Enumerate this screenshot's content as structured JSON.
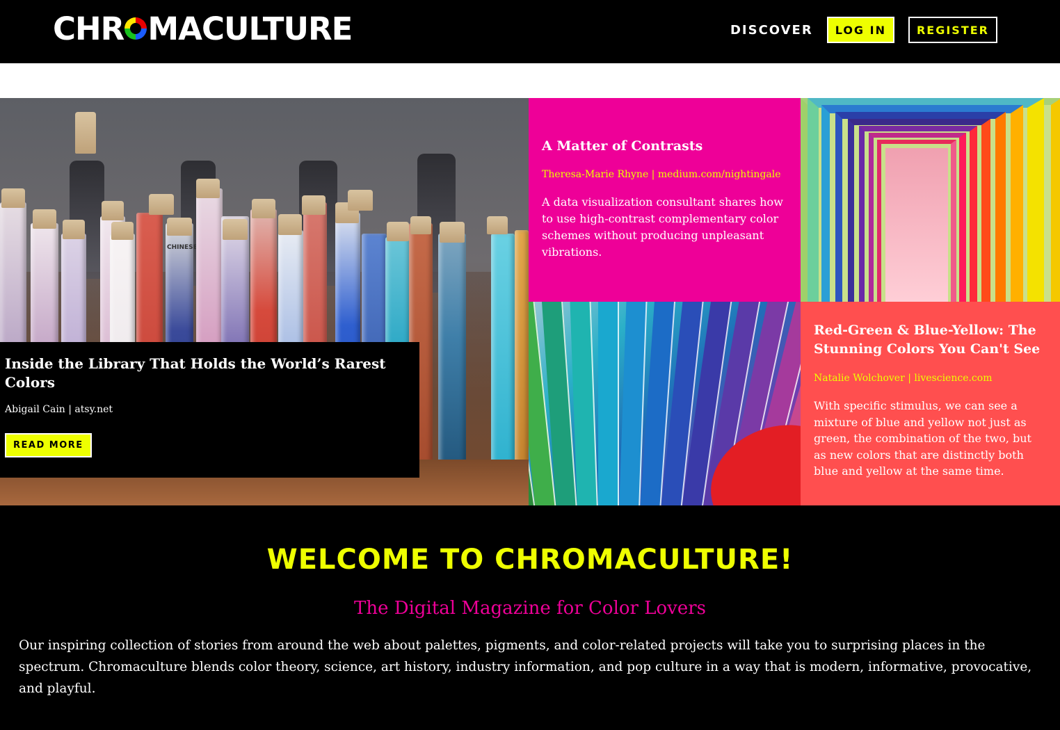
{
  "header": {
    "logo_left": "CHR",
    "logo_right": "MACULTURE",
    "nav": {
      "discover": "DISCOVER",
      "login": "LOG IN",
      "register": "REGISTER"
    }
  },
  "featured": {
    "title": "Inside the Library That Holds the World’s Rarest Colors",
    "byline": "Abigail Cain | atsy.net",
    "read_more": "READ MORE",
    "image_label": "CHINESE"
  },
  "cards": [
    {
      "title": "A Matter of Contrasts",
      "byline": "Theresa-Marie Rhyne | medium.com/nightingale",
      "text": "A data visualization consultant shares how to use high-contrast complementary color schemes without producing unpleasant vibrations."
    },
    {
      "title": "Red-Green & Blue-Yellow: The Stunning Colors You Can't See",
      "byline": "Natalie Wolchover | livescience.com",
      "text": "With specific stimulus, we can see a mixture of blue and yellow not just as green, the combination of the two, but as new colors that are distinctly both blue and yellow at the same time."
    }
  ],
  "welcome": {
    "title": "WELCOME TO CHROMACULTURE!",
    "subtitle": "The Digital Magazine for Color Lovers",
    "body": "Our inspiring collection of stories from around the web about palettes, pigments, and color-related projects will take you to surprising places in the spectrum. Chromaculture blends color theory, science, art history, industry information, and pop culture in a way that is modern, informative, provocative, and playful."
  },
  "colors": {
    "accent_yellow": "#eeff00",
    "accent_pink": "#ee0098",
    "coral": "#ff4f4f",
    "background": "#000000"
  }
}
